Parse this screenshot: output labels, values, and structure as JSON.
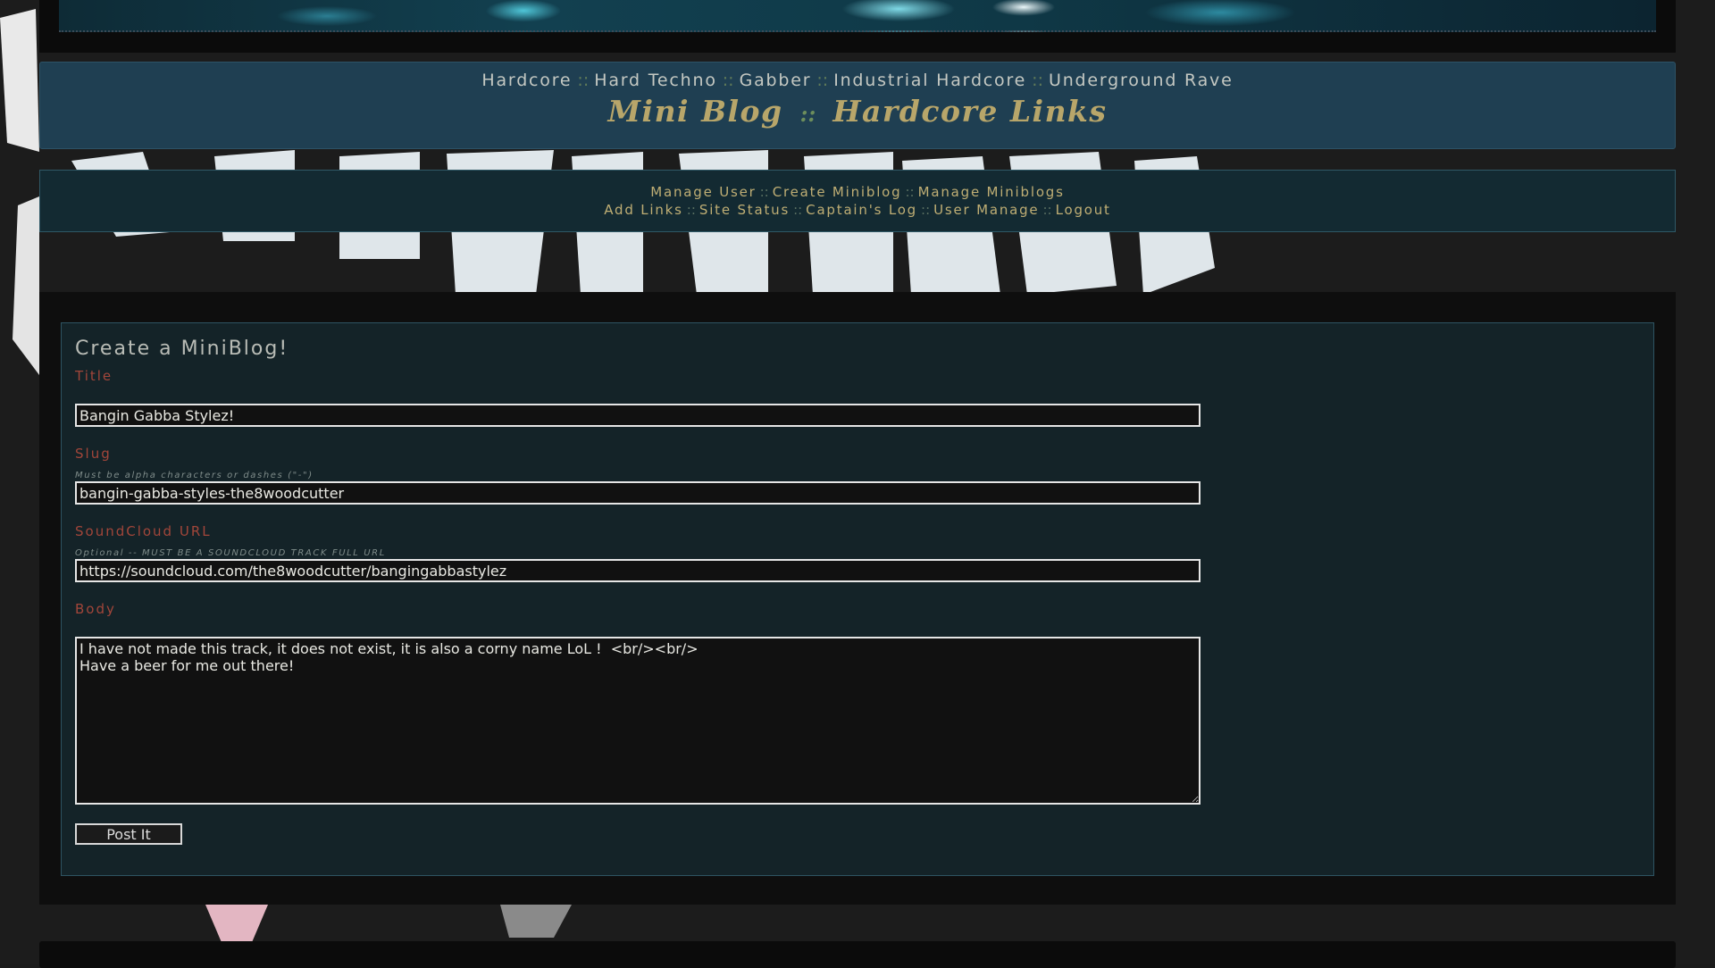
{
  "genre_nav": {
    "items": [
      "Hardcore",
      "Hard Techno",
      "Gabber",
      "Industrial Hardcore",
      "Underground Rave"
    ],
    "separator": "::"
  },
  "site_title": {
    "part1": "Mini Blog",
    "separator": "::",
    "part2": "Hardcore Links"
  },
  "admin_menu": {
    "row1": [
      "Manage User",
      "Create Miniblog",
      "Manage Miniblogs"
    ],
    "row2": [
      "Add Links",
      "Site Status",
      "Captain's Log",
      "User Manage",
      "Logout"
    ],
    "separator": "::"
  },
  "form": {
    "heading": "Create a MiniBlog!",
    "title": {
      "label": "Title",
      "value": "Bangin Gabba Stylez!"
    },
    "slug": {
      "label": "Slug",
      "hint": "Must be alpha characters or dashes (\"-\")",
      "value": "bangin-gabba-styles-the8woodcutter"
    },
    "soundcloud": {
      "label": "SoundCloud URL",
      "hint": "Optional -- MUST BE A SOUNDCLOUD TRACK FULL URL",
      "value": "https://soundcloud.com/the8woodcutter/bangingabbastylez"
    },
    "body": {
      "label": "Body",
      "value": "I have not made this track, it does not exist, it is also a corny name LoL !  <br/><br/>\nHave a beer for me out there!"
    },
    "submit_label": "Post It"
  },
  "colors": {
    "page_bg": "#1b1b1b",
    "title_panel_bg": "#1f3f52",
    "title_gold": "#b8a66a",
    "label_red": "#a2463a",
    "form_panel_bg": "#142328"
  }
}
